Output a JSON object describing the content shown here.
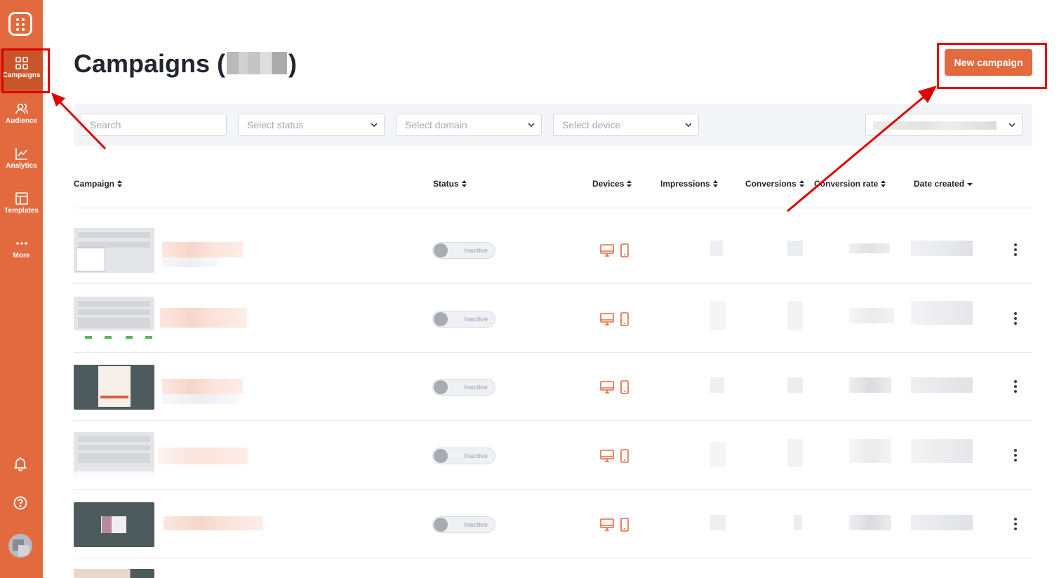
{
  "sidebar": {
    "items": [
      {
        "label": "Campaigns",
        "icon": "grid-icon",
        "active": true
      },
      {
        "label": "Audience",
        "icon": "users-icon",
        "active": false
      },
      {
        "label": "Analytics",
        "icon": "chart-line-icon",
        "active": false
      },
      {
        "label": "Templates",
        "icon": "template-icon",
        "active": false
      },
      {
        "label": "More",
        "icon": "more-dots-icon",
        "active": false
      }
    ]
  },
  "header": {
    "title_prefix": "Campaigns (",
    "title_suffix": ")",
    "new_campaign_label": "New campaign"
  },
  "filters": {
    "search_placeholder": "Search",
    "status_placeholder": "Select status",
    "domain_placeholder": "Select domain",
    "device_placeholder": "Select device"
  },
  "table": {
    "columns": [
      "Campaign",
      "Status",
      "Devices",
      "Impressions",
      "Conversions",
      "Conversion rate",
      "Date created"
    ],
    "rows": [
      {
        "status": "Inactive"
      },
      {
        "status": "Inactive"
      },
      {
        "status": "Inactive"
      },
      {
        "status": "Inactive"
      },
      {
        "status": "Inactive"
      }
    ]
  },
  "colors": {
    "brand": "#e36a3e",
    "brand_dark": "#c95628",
    "annotation": "#e00000"
  }
}
